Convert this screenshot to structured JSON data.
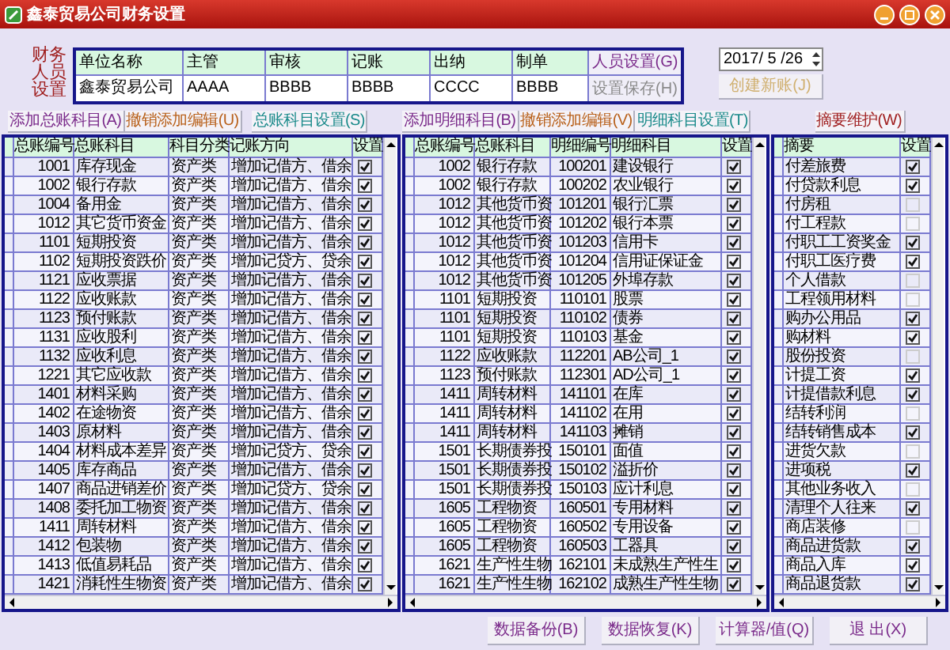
{
  "window": {
    "title": "鑫泰贸易公司财务设置"
  },
  "staff": {
    "label": "财务人员设置",
    "columns": [
      "单位名称",
      "主管",
      "审核",
      "记账",
      "出纳",
      "制单"
    ],
    "values": [
      "鑫泰贸易公司",
      "AAAA",
      "BBBB",
      "BBBB",
      "CCCC",
      "BBBB"
    ],
    "buttons": [
      {
        "label": "人员设置(G)",
        "disabled": false
      },
      {
        "label": "设置保存(H)",
        "disabled": true
      }
    ]
  },
  "date": {
    "value": "2017/ 5 /26"
  },
  "create_button": {
    "label": "创建新账(J)",
    "disabled": true
  },
  "ledger": {
    "buttons": [
      {
        "label": "添加总账科目(A)",
        "kind": "add"
      },
      {
        "label": "撤销添加编辑(U)",
        "kind": "undo"
      },
      {
        "label": "总账科目设置(S)",
        "kind": "settings"
      }
    ],
    "columns": [
      "总账编号",
      "总账科目",
      "科目分类",
      "记账方向",
      "设置"
    ],
    "rows": [
      {
        "code": "1001",
        "name": "库存现金",
        "category": "资产类",
        "direction": "增加记借方、借余",
        "checked": true
      },
      {
        "code": "1002",
        "name": "银行存款",
        "category": "资产类",
        "direction": "增加记借方、借余",
        "checked": true
      },
      {
        "code": "1004",
        "name": "备用金",
        "category": "资产类",
        "direction": "增加记借方、借余",
        "checked": true
      },
      {
        "code": "1012",
        "name": "其它货币资金",
        "category": "资产类",
        "direction": "增加记借方、借余",
        "checked": true
      },
      {
        "code": "1101",
        "name": "短期投资",
        "category": "资产类",
        "direction": "增加记借方、借余",
        "checked": true
      },
      {
        "code": "1102",
        "name": "短期投资跌价",
        "category": "资产类",
        "direction": "增加记贷方、贷余",
        "checked": true
      },
      {
        "code": "1121",
        "name": "应收票据",
        "category": "资产类",
        "direction": "增加记借方、借余",
        "checked": true
      },
      {
        "code": "1122",
        "name": "应收账款",
        "category": "资产类",
        "direction": "增加记借方、借余",
        "checked": true
      },
      {
        "code": "1123",
        "name": "预付账款",
        "category": "资产类",
        "direction": "增加记借方、借余",
        "checked": true
      },
      {
        "code": "1131",
        "name": "应收股利",
        "category": "资产类",
        "direction": "增加记借方、借余",
        "checked": true
      },
      {
        "code": "1132",
        "name": "应收利息",
        "category": "资产类",
        "direction": "增加记借方、借余",
        "checked": true
      },
      {
        "code": "1221",
        "name": "其它应收款",
        "category": "资产类",
        "direction": "增加记借方、借余",
        "checked": true
      },
      {
        "code": "1401",
        "name": "材料采购",
        "category": "资产类",
        "direction": "增加记借方、借余",
        "checked": true
      },
      {
        "code": "1402",
        "name": "在途物资",
        "category": "资产类",
        "direction": "增加记借方、借余",
        "checked": true
      },
      {
        "code": "1403",
        "name": "原材料",
        "category": "资产类",
        "direction": "增加记借方、借余",
        "checked": true
      },
      {
        "code": "1404",
        "name": "材料成本差异",
        "category": "资产类",
        "direction": "增加记贷方、贷余",
        "checked": true
      },
      {
        "code": "1405",
        "name": "库存商品",
        "category": "资产类",
        "direction": "增加记借方、借余",
        "checked": true
      },
      {
        "code": "1407",
        "name": "商品进销差价",
        "category": "资产类",
        "direction": "增加记贷方、贷余",
        "checked": true
      },
      {
        "code": "1408",
        "name": "委托加工物资",
        "category": "资产类",
        "direction": "增加记借方、借余",
        "checked": true
      },
      {
        "code": "1411",
        "name": "周转材料",
        "category": "资产类",
        "direction": "增加记借方、借余",
        "checked": true
      },
      {
        "code": "1412",
        "name": "包装物",
        "category": "资产类",
        "direction": "增加记借方、借余",
        "checked": true
      },
      {
        "code": "1413",
        "name": "低值易耗品",
        "category": "资产类",
        "direction": "增加记借方、借余",
        "checked": true
      },
      {
        "code": "1421",
        "name": "消耗性生物资",
        "category": "资产类",
        "direction": "增加记借方、借余",
        "checked": true
      }
    ]
  },
  "detail": {
    "buttons": [
      {
        "label": "添加明细科目(B)",
        "kind": "add"
      },
      {
        "label": "撤销添加编辑(V)",
        "kind": "undo"
      },
      {
        "label": "明细科目设置(T)",
        "kind": "settings"
      }
    ],
    "columns": [
      "总账编号",
      "总账科目",
      "明细编号",
      "明细科目",
      "设置"
    ],
    "rows": [
      {
        "code": "1002",
        "name": "银行存款",
        "detail_code": "100201",
        "detail_name": "建设银行",
        "checked": true
      },
      {
        "code": "1002",
        "name": "银行存款",
        "detail_code": "100202",
        "detail_name": "农业银行",
        "checked": true
      },
      {
        "code": "1012",
        "name": "其他货币资",
        "detail_code": "101201",
        "detail_name": "银行汇票",
        "checked": true
      },
      {
        "code": "1012",
        "name": "其他货币资",
        "detail_code": "101202",
        "detail_name": "银行本票",
        "checked": true
      },
      {
        "code": "1012",
        "name": "其他货币资",
        "detail_code": "101203",
        "detail_name": "信用卡",
        "checked": true
      },
      {
        "code": "1012",
        "name": "其他货币资",
        "detail_code": "101204",
        "detail_name": "信用证保证金",
        "checked": true
      },
      {
        "code": "1012",
        "name": "其他货币资",
        "detail_code": "101205",
        "detail_name": "外埠存款",
        "checked": true
      },
      {
        "code": "1101",
        "name": "短期投资",
        "detail_code": "110101",
        "detail_name": "股票",
        "checked": true
      },
      {
        "code": "1101",
        "name": "短期投资",
        "detail_code": "110102",
        "detail_name": "债券",
        "checked": true
      },
      {
        "code": "1101",
        "name": "短期投资",
        "detail_code": "110103",
        "detail_name": "基金",
        "checked": true
      },
      {
        "code": "1122",
        "name": "应收账款",
        "detail_code": "112201",
        "detail_name": "AB公司_1",
        "checked": true
      },
      {
        "code": "1123",
        "name": "预付账款",
        "detail_code": "112301",
        "detail_name": "AD公司_1",
        "checked": true
      },
      {
        "code": "1411",
        "name": "周转材料",
        "detail_code": "141101",
        "detail_name": "在库",
        "checked": true
      },
      {
        "code": "1411",
        "name": "周转材料",
        "detail_code": "141102",
        "detail_name": "在用",
        "checked": true
      },
      {
        "code": "1411",
        "name": "周转材料",
        "detail_code": "141103",
        "detail_name": "摊销",
        "checked": true
      },
      {
        "code": "1501",
        "name": "长期债券投",
        "detail_code": "150101",
        "detail_name": "面值",
        "checked": true
      },
      {
        "code": "1501",
        "name": "长期债券投",
        "detail_code": "150102",
        "detail_name": "溢折价",
        "checked": true
      },
      {
        "code": "1501",
        "name": "长期债券投",
        "detail_code": "150103",
        "detail_name": "应计利息",
        "checked": true
      },
      {
        "code": "1605",
        "name": "工程物资",
        "detail_code": "160501",
        "detail_name": "专用材料",
        "checked": true
      },
      {
        "code": "1605",
        "name": "工程物资",
        "detail_code": "160502",
        "detail_name": "专用设备",
        "checked": true
      },
      {
        "code": "1605",
        "name": "工程物资",
        "detail_code": "160503",
        "detail_name": "工器具",
        "checked": true
      },
      {
        "code": "1621",
        "name": "生产性生物",
        "detail_code": "162101",
        "detail_name": "未成熟生产性生",
        "checked": true
      },
      {
        "code": "1621",
        "name": "生产性生物",
        "detail_code": "162102",
        "detail_name": "成熟生产性生物",
        "checked": true
      }
    ]
  },
  "summary": {
    "button": {
      "label": "摘要维护(W)"
    },
    "columns": [
      "摘要",
      "设置"
    ],
    "rows": [
      {
        "text": "付差旅费",
        "checked": true
      },
      {
        "text": "付贷款利息",
        "checked": true
      },
      {
        "text": "付房租",
        "checked": false
      },
      {
        "text": "付工程款",
        "checked": false
      },
      {
        "text": "付职工工资奖金",
        "checked": true
      },
      {
        "text": "付职工医疗费",
        "checked": true
      },
      {
        "text": "个人借款",
        "checked": false
      },
      {
        "text": "工程领用材料",
        "checked": false
      },
      {
        "text": "购办公用品",
        "checked": true
      },
      {
        "text": "购材料",
        "checked": true
      },
      {
        "text": "股份投资",
        "checked": false
      },
      {
        "text": "计提工资",
        "checked": true
      },
      {
        "text": "计提借款利息",
        "checked": true
      },
      {
        "text": "结转利润",
        "checked": false
      },
      {
        "text": "结转销售成本",
        "checked": true
      },
      {
        "text": "进货欠款",
        "checked": false
      },
      {
        "text": "进项税",
        "checked": true
      },
      {
        "text": "其他业务收入",
        "checked": false
      },
      {
        "text": "清理个人往来",
        "checked": true
      },
      {
        "text": "商店装修",
        "checked": false
      },
      {
        "text": "商品进货款",
        "checked": true
      },
      {
        "text": "商品入库",
        "checked": true
      },
      {
        "text": "商品退货款",
        "checked": true
      }
    ]
  },
  "footer_buttons": [
    {
      "label": "数据备份(B)"
    },
    {
      "label": "数据恢复(K)"
    },
    {
      "label": "计算器/值(Q)"
    },
    {
      "label": "退 出(X)"
    }
  ]
}
